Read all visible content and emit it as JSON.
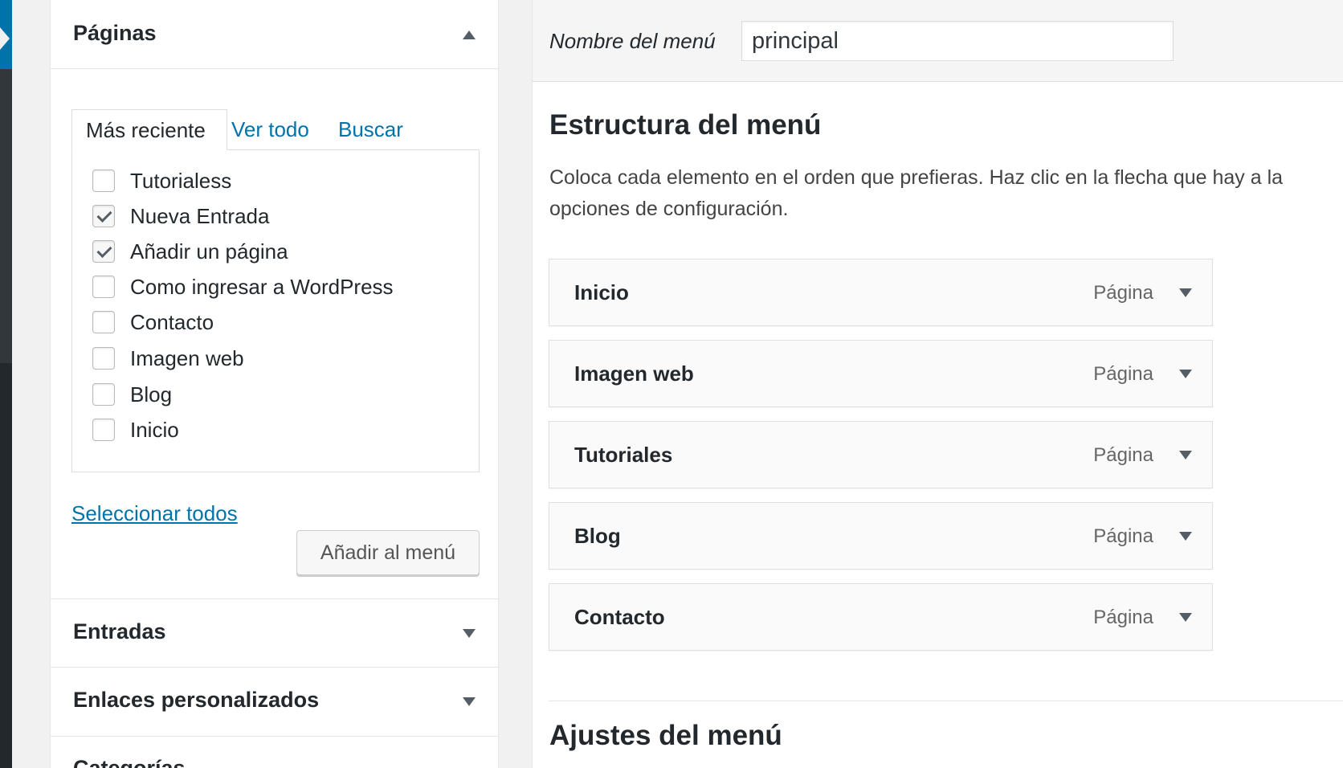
{
  "accordion": {
    "paginas": {
      "title": "Páginas"
    },
    "entradas": {
      "title": "Entradas"
    },
    "enlaces": {
      "title": "Enlaces personalizados"
    },
    "categorias": {
      "title": "Categorías"
    }
  },
  "tabs": {
    "recent": "Más reciente",
    "all": "Ver todo",
    "search": "Buscar"
  },
  "pages": [
    {
      "label": "Tutorialess",
      "checked": false
    },
    {
      "label": "Nueva Entrada",
      "checked": true
    },
    {
      "label": "Añadir un página",
      "checked": true
    },
    {
      "label": "Como ingresar a WordPress",
      "checked": false
    },
    {
      "label": "Contacto",
      "checked": false
    },
    {
      "label": "Imagen web",
      "checked": false
    },
    {
      "label": "Blog",
      "checked": false
    },
    {
      "label": "Inicio",
      "checked": false
    }
  ],
  "select_all": "Seleccionar todos",
  "add_button": "Añadir al menú",
  "menu_name": {
    "label": "Nombre del menú",
    "value": "principal"
  },
  "structure": {
    "title": "Estructura del menú",
    "desc_line1": "Coloca cada elemento en el orden que prefieras. Haz clic en la flecha que hay a la",
    "desc_line2": "opciones de configuración."
  },
  "menu_items": [
    {
      "title": "Inicio",
      "type": "Página"
    },
    {
      "title": "Imagen web",
      "type": "Página"
    },
    {
      "title": "Tutoriales",
      "type": "Página"
    },
    {
      "title": "Blog",
      "type": "Página"
    },
    {
      "title": "Contacto",
      "type": "Página"
    }
  ],
  "settings": {
    "title": "Ajustes del menú"
  }
}
